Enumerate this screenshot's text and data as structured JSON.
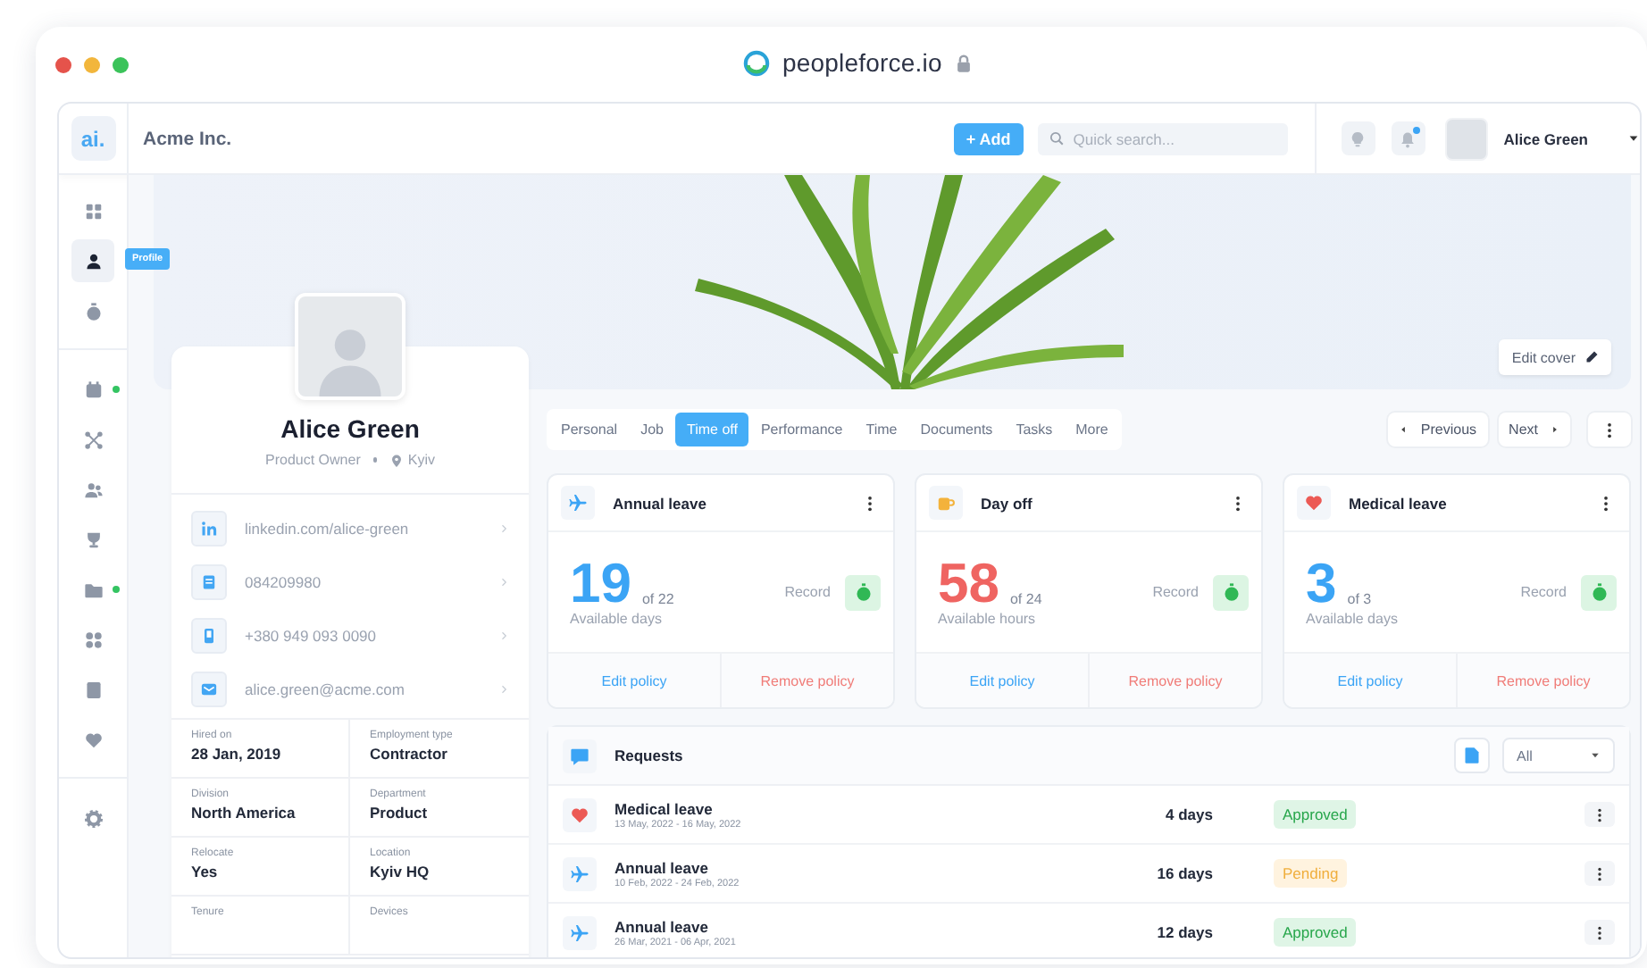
{
  "browser": {
    "url": "peopleforce.io"
  },
  "header": {
    "logo": "ai.",
    "company": "Acme Inc.",
    "add_button": "+ Add",
    "search": {
      "placeholder": "Quick search..."
    },
    "notification": true,
    "user": "Alice Green"
  },
  "sidebar": {
    "tooltip": "Profile",
    "items": [
      {
        "selected": false,
        "dot": false
      },
      {
        "selected": true,
        "dot": false
      },
      {
        "selected": false,
        "dot": false
      },
      {
        "selected": false,
        "dot": true
      },
      {
        "selected": false,
        "dot": false
      },
      {
        "selected": false,
        "dot": false
      },
      {
        "selected": false,
        "dot": false
      },
      {
        "selected": false,
        "dot": true
      },
      {
        "selected": false,
        "dot": false
      },
      {
        "selected": false,
        "dot": false
      },
      {
        "selected": false,
        "dot": false
      },
      {
        "selected": false,
        "dot": false
      }
    ]
  },
  "cover": {
    "edit_button": "Edit cover"
  },
  "profile": {
    "name": "Alice Green",
    "title": "Product Owner",
    "location": "Kyiv",
    "contacts": [
      {
        "kind": "linkedin",
        "text": "linkedin.com/alice-green"
      },
      {
        "kind": "id",
        "text": "084209980"
      },
      {
        "kind": "phone",
        "text": "+380 949 093 0090"
      },
      {
        "kind": "email",
        "text": "alice.green@acme.com"
      }
    ],
    "facts": [
      {
        "label": "Hired on",
        "value": "28 Jan, 2019"
      },
      {
        "label": "Employment type",
        "value": "Contractor"
      },
      {
        "label": "Division",
        "value": "North America"
      },
      {
        "label": "Department",
        "value": "Product"
      },
      {
        "label": "Relocate",
        "value": "Yes"
      },
      {
        "label": "Location",
        "value": "Kyiv HQ"
      },
      {
        "label": "Tenure"
      },
      {
        "label": "Devices"
      }
    ]
  },
  "tabs": [
    {
      "label": "Personal",
      "selected": false
    },
    {
      "label": "Job",
      "selected": false
    },
    {
      "label": "Time off",
      "selected": true
    },
    {
      "label": "Performance",
      "selected": false
    },
    {
      "label": "Time",
      "selected": false
    },
    {
      "label": "Documents",
      "selected": false
    },
    {
      "label": "Tasks",
      "selected": false
    },
    {
      "label": "More",
      "selected": false
    }
  ],
  "pager": {
    "previous": "Previous",
    "next": "Next"
  },
  "leave_cards": [
    {
      "kind": "plane",
      "title": "Annual leave",
      "value": "19",
      "total": "of 22",
      "unit": "Available days",
      "color": "#3ba4f5",
      "record": "Record",
      "edit": "Edit policy",
      "remove": "Remove policy"
    },
    {
      "kind": "cup",
      "title": "Day off",
      "value": "58",
      "total": "of 24",
      "unit": "Available hours",
      "color": "#ef6461",
      "record": "Record",
      "edit": "Edit policy",
      "remove": "Remove policy"
    },
    {
      "kind": "heart",
      "title": "Medical leave",
      "value": "3",
      "total": "of 3",
      "unit": "Available days",
      "color": "#3ba4f5",
      "record": "Record",
      "edit": "Edit policy",
      "remove": "Remove policy"
    }
  ],
  "requests": {
    "title": "Requests",
    "filter": "All",
    "rows": [
      {
        "kind": "heart",
        "title": "Medical leave",
        "dates": "13 May, 2022 - 16 May, 2022",
        "duration": "4 days",
        "status": {
          "text": "Approved",
          "kind": "approved"
        }
      },
      {
        "kind": "plane",
        "title": "Annual leave",
        "dates": "10 Feb, 2022 - 24 Feb, 2022",
        "duration": "16 days",
        "status": {
          "text": "Pending",
          "kind": "pending"
        }
      },
      {
        "kind": "plane",
        "title": "Annual leave",
        "dates": "26 Mar, 2021 - 06 Apr, 2021",
        "duration": "12 days",
        "status": {
          "text": "Approved",
          "kind": "approved"
        }
      }
    ]
  }
}
